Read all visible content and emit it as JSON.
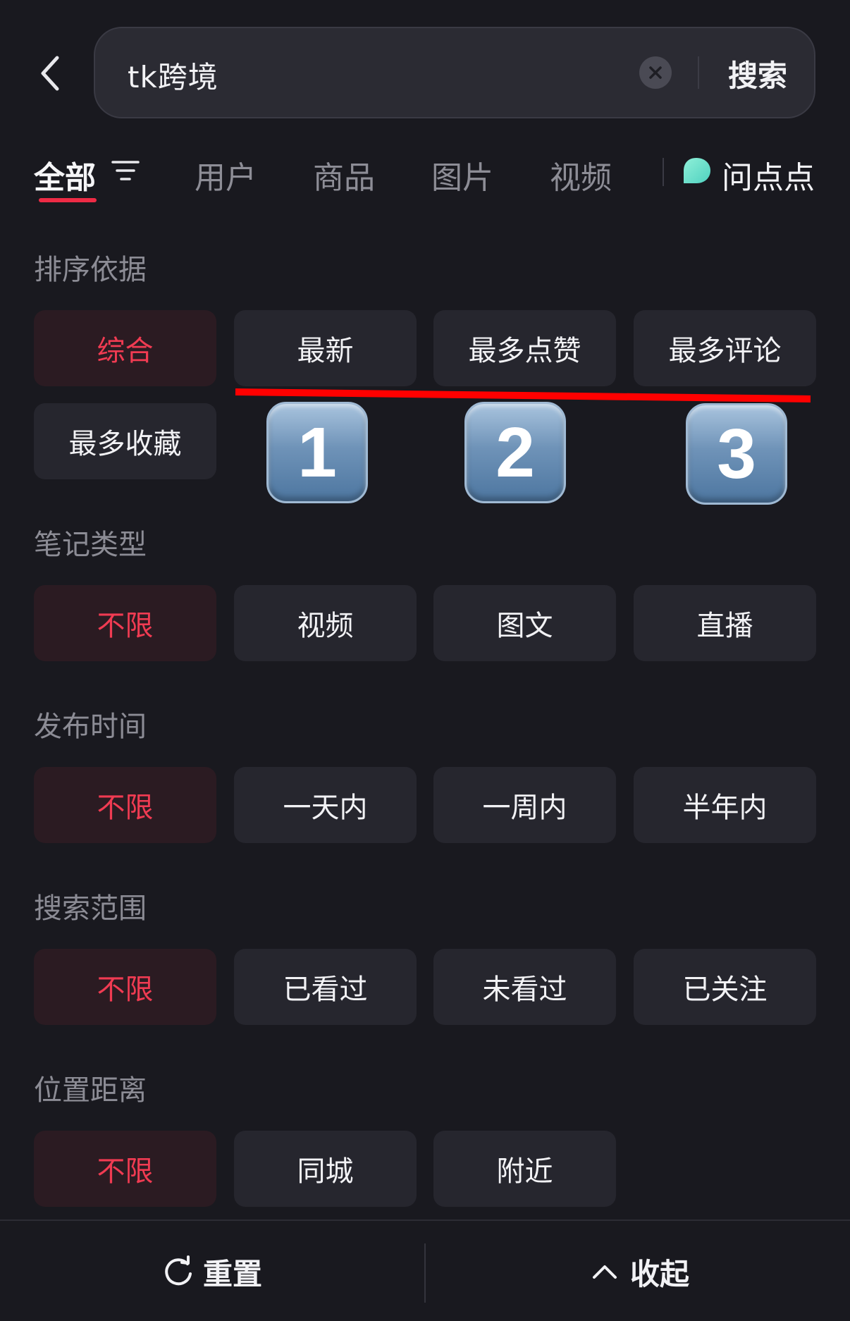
{
  "search": {
    "query": "tk跨境",
    "button_label": "搜索"
  },
  "tabs": [
    {
      "label": "全部",
      "active": true
    },
    {
      "label": "用户"
    },
    {
      "label": "商品"
    },
    {
      "label": "图片"
    },
    {
      "label": "视频"
    },
    {
      "label": "问点点"
    }
  ],
  "sections": {
    "sort": {
      "title": "排序依据",
      "options": [
        "综合",
        "最新",
        "最多点赞",
        "最多评论",
        "最多收藏"
      ],
      "selected": "综合"
    },
    "note_type": {
      "title": "笔记类型",
      "options": [
        "不限",
        "视频",
        "图文",
        "直播"
      ],
      "selected": "不限"
    },
    "publish_time": {
      "title": "发布时间",
      "options": [
        "不限",
        "一天内",
        "一周内",
        "半年内"
      ],
      "selected": "不限"
    },
    "search_scope": {
      "title": "搜索范围",
      "options": [
        "不限",
        "已看过",
        "未看过",
        "已关注"
      ],
      "selected": "不限"
    },
    "distance": {
      "title": "位置距离",
      "options": [
        "不限",
        "同城",
        "附近"
      ],
      "selected": "不限"
    }
  },
  "annotations": {
    "numbers": [
      "1",
      "2",
      "3"
    ],
    "line_color": "#ff0000"
  },
  "bottom": {
    "reset_label": "重置",
    "collapse_label": "收起"
  },
  "colors": {
    "accent": "#f03b52",
    "background": "#19191f",
    "chip": "#26262e"
  },
  "icons": [
    "back-icon",
    "clear-icon",
    "filter-icon",
    "ai-chat-icon",
    "refresh-icon",
    "chevron-up-icon"
  ]
}
